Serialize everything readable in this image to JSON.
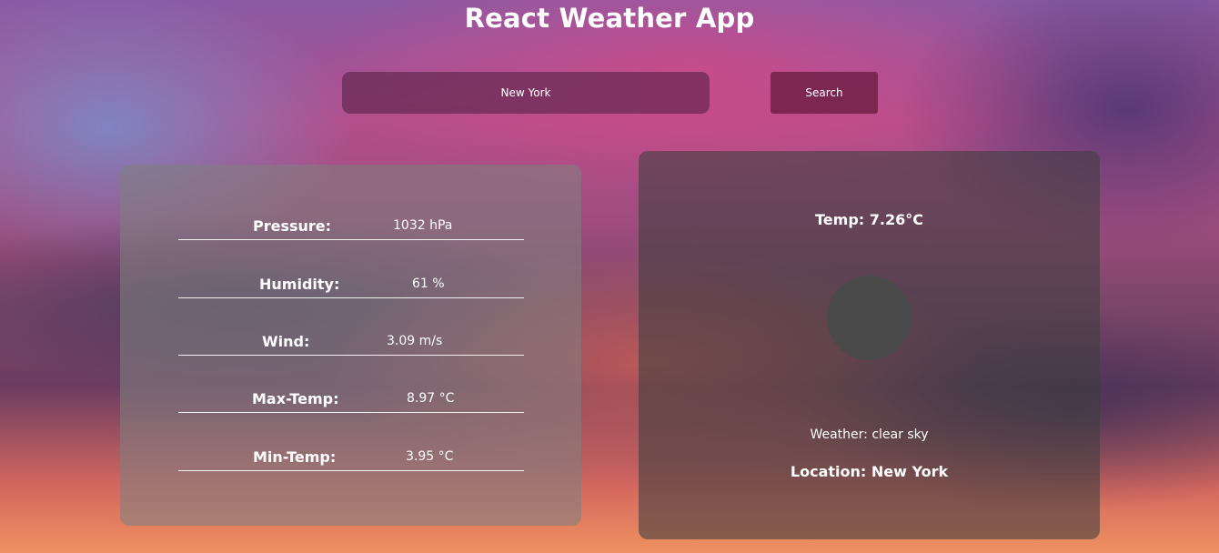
{
  "app": {
    "title": "React Weather App"
  },
  "search": {
    "value": "New York",
    "placeholder": "",
    "button_label": "Search"
  },
  "details": {
    "rows": [
      {
        "label": "Pressure:",
        "value": "1032 hPa"
      },
      {
        "label": "Humidity:",
        "value": "61 %"
      },
      {
        "label": "Wind:",
        "value": "3.09 m/s"
      },
      {
        "label": "Max-Temp:",
        "value": "8.97 °C"
      },
      {
        "label": "Min-Temp:",
        "value": "3.95 °C"
      }
    ]
  },
  "current": {
    "temp": "Temp: 7.26°C",
    "weather_icon": "weather-icon",
    "weather": "Weather: clear sky",
    "location": "Location: New York"
  },
  "colors": {
    "text": "#ffffff",
    "icon_placeholder": "#4a4a4a"
  }
}
